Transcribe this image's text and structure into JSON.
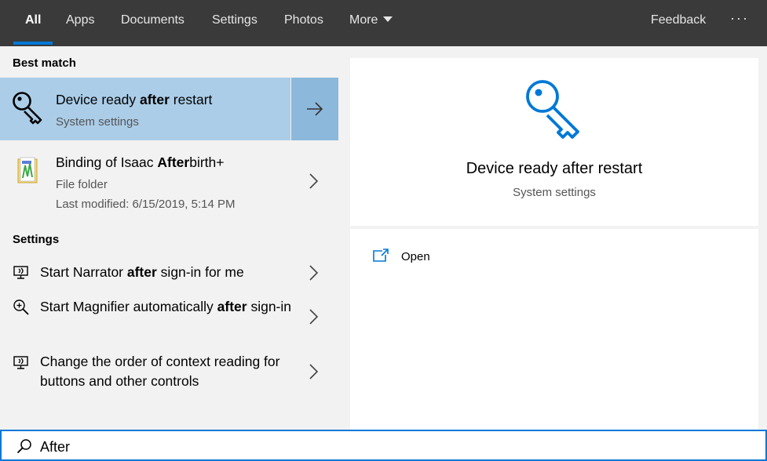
{
  "topbar": {
    "tabs": [
      {
        "label": "All",
        "active": true
      },
      {
        "label": "Apps"
      },
      {
        "label": "Documents"
      },
      {
        "label": "Settings"
      },
      {
        "label": "Photos"
      },
      {
        "label": "More"
      }
    ],
    "feedback_label": "Feedback",
    "more_options_label": "···"
  },
  "left": {
    "best_match_header": "Best match",
    "best_match": {
      "title_pre": "Device ready ",
      "title_bold": "after",
      "title_post": " restart",
      "subtitle": "System settings",
      "icon": "key-icon"
    },
    "folder_result": {
      "title_pre": "Binding of Isaac ",
      "title_bold": "After",
      "title_post": "birth+",
      "type": "File folder",
      "modified": "Last modified: 6/15/2019, 5:14 PM",
      "icon": "folder-icon"
    },
    "settings_header": "Settings",
    "settings": [
      {
        "pre": "Start Narrator ",
        "bold": "after",
        "post": " sign-in for me",
        "icon": "narrator-icon"
      },
      {
        "pre": "Start Magnifier automatically ",
        "bold": "after",
        "post": " sign-in",
        "icon": "magnifier-icon"
      },
      {
        "pre": "Change the order of context reading for buttons and other controls",
        "bold": "",
        "post": "",
        "icon": "narrator-icon"
      }
    ]
  },
  "preview": {
    "title": "Device ready after restart",
    "subtitle": "System settings",
    "open_label": "Open",
    "icon": "key-icon"
  },
  "search": {
    "value": "After",
    "icon": "search-icon"
  },
  "colors": {
    "accent": "#0078d7",
    "selected": "#abcde8",
    "topbar": "#3a3a3a"
  }
}
